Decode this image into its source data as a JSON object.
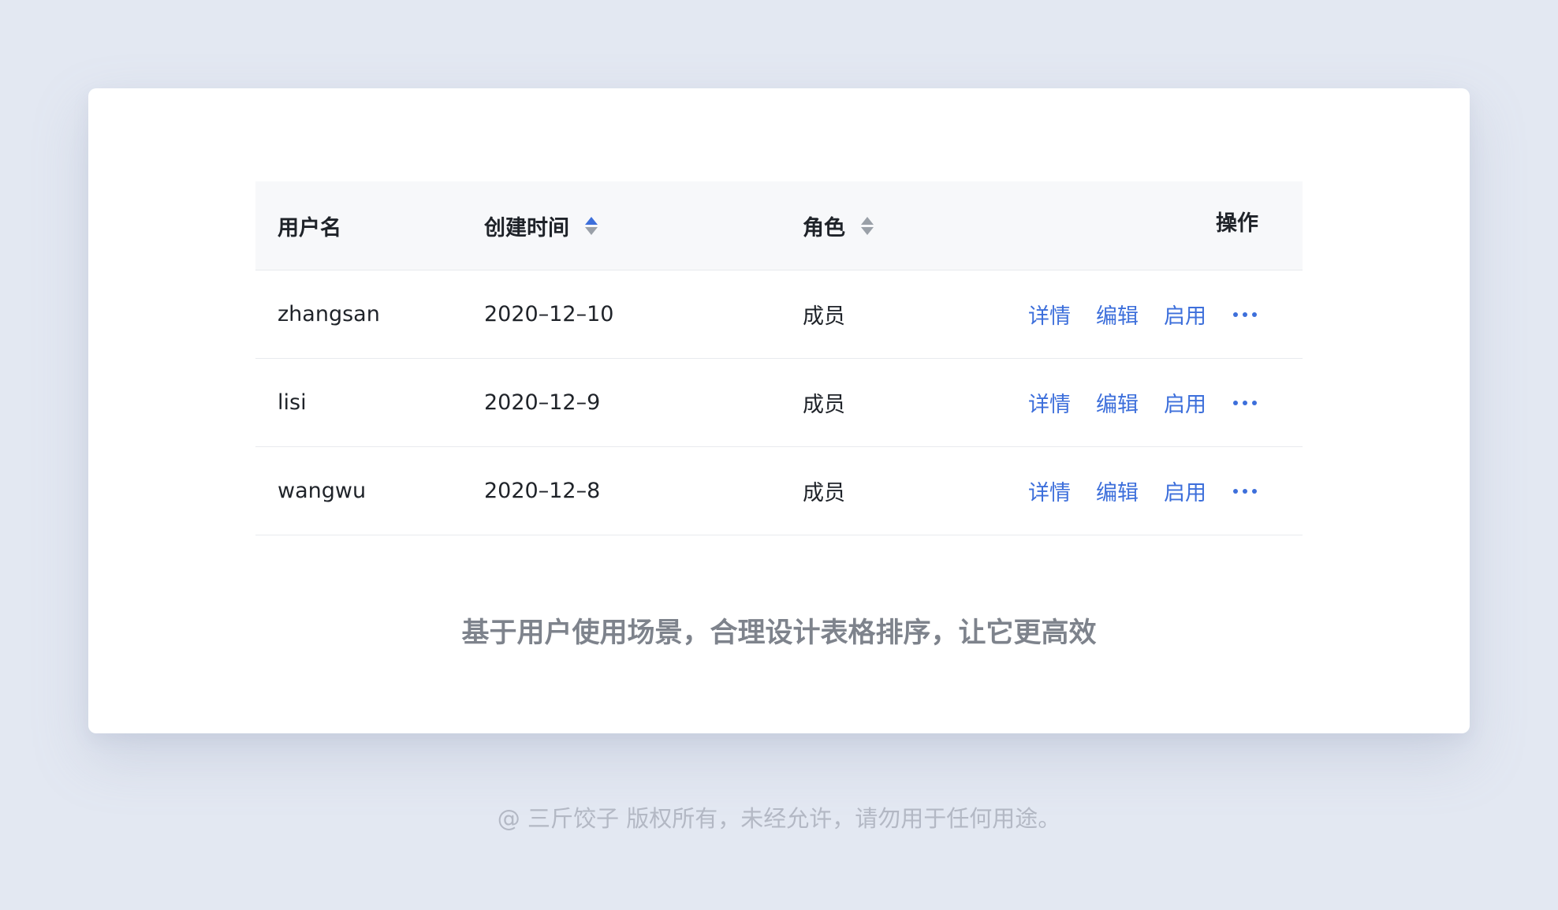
{
  "table": {
    "headers": {
      "username": "用户名",
      "created_time": "创建时间",
      "role": "角色",
      "actions": "操作"
    },
    "sort": {
      "created_time": "ascending",
      "role": "none"
    },
    "rows": [
      {
        "username": "zhangsan",
        "created_time": "2020–12–10",
        "role": "成员"
      },
      {
        "username": "lisi",
        "created_time": "2020–12–9",
        "role": "成员"
      },
      {
        "username": "wangwu",
        "created_time": "2020–12–8",
        "role": "成员"
      }
    ],
    "actions": {
      "details": "详情",
      "edit": "编辑",
      "enable": "启用",
      "more": "more-icon"
    }
  },
  "caption": "基于用户使用场景，合理设计表格排序，让它更高效",
  "copyright": "@ 三斤饺子  版权所有，未经允许，请勿用于任何用途。",
  "colors": {
    "background": "#e3e8f2",
    "accent": "#3d6fdb",
    "header_bg": "#f7f8fa",
    "caption": "#7e838c"
  }
}
